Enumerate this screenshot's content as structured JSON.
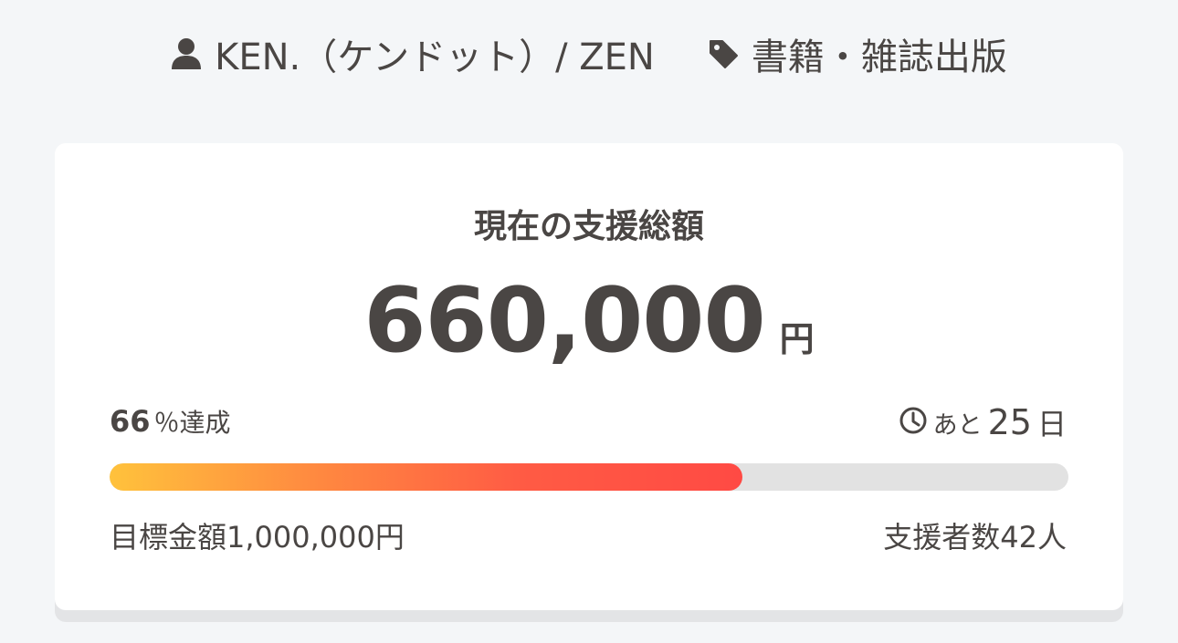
{
  "meta": {
    "owner": "KEN.（ケンドット）/ ZEN",
    "category": "書籍・雑誌出版",
    "owner_icon": "user-icon",
    "category_icon": "tag-icon"
  },
  "funding": {
    "title": "現在の支援総額",
    "amount": "660,000",
    "currency": "円",
    "rate_value": "66",
    "rate_label": "％達成",
    "progress_percent": 66,
    "remaining_prefix": "あと",
    "remaining_days": "25",
    "remaining_unit": "日",
    "clock_icon": "clock-icon",
    "goal_label": "目標金額1,000,000円",
    "backers_label": "支援者数42人"
  },
  "colors": {
    "progress_start": "#ffc23c",
    "progress_end": "#ff4a44",
    "progress_track": "#e2e2e2",
    "text": "#4a4644",
    "background": "#f4f6f8"
  }
}
